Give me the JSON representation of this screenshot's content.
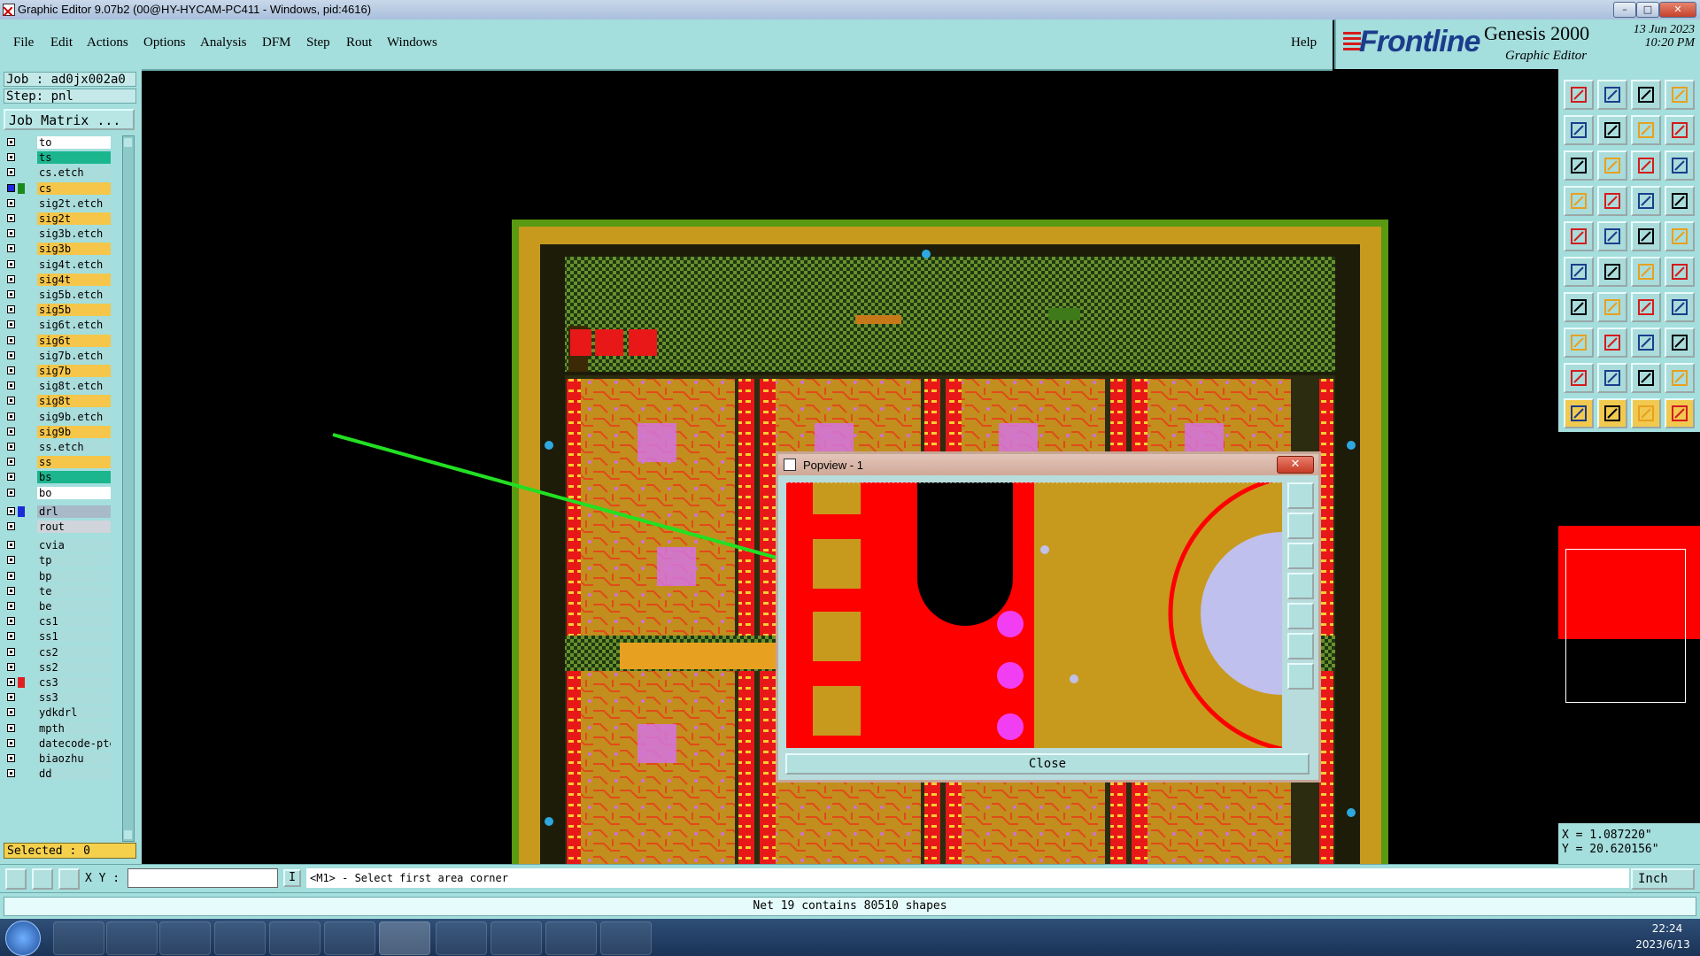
{
  "window": {
    "title": "Graphic Editor 9.07b2 (00@HY-HYCAM-PC411 - Windows, pid:4616)"
  },
  "menu": [
    "File",
    "Edit",
    "Actions",
    "Options",
    "Analysis",
    "DFM",
    "Step",
    "Rout",
    "Windows"
  ],
  "help": "Help",
  "brand": {
    "logo": "Frontline",
    "product": "Genesis 2000",
    "subtitle": "Graphic Editor",
    "date": "13 Jun 2023",
    "time": "10:20 PM"
  },
  "job": {
    "job_line": "Job : ad0jx002a0",
    "step_line": "Step: pnl",
    "matrix_button": "Job Matrix ..."
  },
  "layers": [
    {
      "name": "to",
      "bg": "#ffffff",
      "swatch": ""
    },
    {
      "name": "ts",
      "bg": "#1bb58e",
      "swatch": ""
    },
    {
      "name": "cs.etch",
      "bg": "#a9dcdb",
      "swatch": ""
    },
    {
      "name": "cs",
      "bg": "#f5c64a",
      "swatch": "#1b8c1b",
      "checked": true
    },
    {
      "name": "sig2t.etch",
      "bg": "#a9dcdb",
      "swatch": ""
    },
    {
      "name": "sig2t",
      "bg": "#f5c64a",
      "swatch": ""
    },
    {
      "name": "sig3b.etch",
      "bg": "#a9dcdb",
      "swatch": ""
    },
    {
      "name": "sig3b",
      "bg": "#f5c64a",
      "swatch": ""
    },
    {
      "name": "sig4t.etch",
      "bg": "#a9dcdb",
      "swatch": ""
    },
    {
      "name": "sig4t",
      "bg": "#f5c64a",
      "swatch": ""
    },
    {
      "name": "sig5b.etch",
      "bg": "#a9dcdb",
      "swatch": ""
    },
    {
      "name": "sig5b",
      "bg": "#f5c64a",
      "swatch": ""
    },
    {
      "name": "sig6t.etch",
      "bg": "#a9dcdb",
      "swatch": ""
    },
    {
      "name": "sig6t",
      "bg": "#f5c64a",
      "swatch": ""
    },
    {
      "name": "sig7b.etch",
      "bg": "#a9dcdb",
      "swatch": ""
    },
    {
      "name": "sig7b",
      "bg": "#f5c64a",
      "swatch": ""
    },
    {
      "name": "sig8t.etch",
      "bg": "#a9dcdb",
      "swatch": ""
    },
    {
      "name": "sig8t",
      "bg": "#f5c64a",
      "swatch": ""
    },
    {
      "name": "sig9b.etch",
      "bg": "#a9dcdb",
      "swatch": ""
    },
    {
      "name": "sig9b",
      "bg": "#f5c64a",
      "swatch": ""
    },
    {
      "name": "ss.etch",
      "bg": "#a9dcdb",
      "swatch": ""
    },
    {
      "name": "ss",
      "bg": "#f5c64a",
      "swatch": ""
    },
    {
      "name": "bs",
      "bg": "#1bb58e",
      "swatch": ""
    },
    {
      "name": "bo",
      "bg": "#ffffff",
      "swatch": ""
    },
    {
      "name": "drl",
      "bg": "#a8b9c8",
      "swatch": "#1b2bd8"
    },
    {
      "name": "rout",
      "bg": "#cfd5db",
      "swatch": ""
    },
    {
      "name": "cvia",
      "bg": "#a9dcdb",
      "swatch": ""
    },
    {
      "name": "tp",
      "bg": "#a9dcdb",
      "swatch": ""
    },
    {
      "name": "bp",
      "bg": "#a9dcdb",
      "swatch": ""
    },
    {
      "name": "te",
      "bg": "#a9dcdb",
      "swatch": ""
    },
    {
      "name": "be",
      "bg": "#a9dcdb",
      "swatch": ""
    },
    {
      "name": "cs1",
      "bg": "#a9dcdb",
      "swatch": ""
    },
    {
      "name": "ss1",
      "bg": "#a9dcdb",
      "swatch": ""
    },
    {
      "name": "cs2",
      "bg": "#a9dcdb",
      "swatch": ""
    },
    {
      "name": "ss2",
      "bg": "#a9dcdb",
      "swatch": ""
    },
    {
      "name": "cs3",
      "bg": "#a9dcdb",
      "swatch": "#e02020"
    },
    {
      "name": "ss3",
      "bg": "#a9dcdb",
      "swatch": ""
    },
    {
      "name": "ydkdrl",
      "bg": "#a9dcdb",
      "swatch": ""
    },
    {
      "name": "mpth",
      "bg": "#a9dcdb",
      "swatch": ""
    },
    {
      "name": "datecode-pte",
      "bg": "#a9dcdb",
      "swatch": ""
    },
    {
      "name": "biaozhu",
      "bg": "#a9dcdb",
      "swatch": ""
    },
    {
      "name": "dd",
      "bg": "#a9dcdb",
      "swatch": ""
    }
  ],
  "selected": "Selected : 0",
  "command": {
    "xy_label": "X Y :",
    "xy_value": "",
    "prompt": "<M1> - Select first area corner",
    "units": "Inch"
  },
  "status": "Net 19 contains 80510 shapes",
  "cursor": {
    "x": "X = 1.087220\"",
    "y": "Y = 20.620156\""
  },
  "popview": {
    "title": "Popview - 1",
    "close": "Close"
  },
  "tray": {
    "time": "22:24",
    "date": "2023/6/13"
  }
}
